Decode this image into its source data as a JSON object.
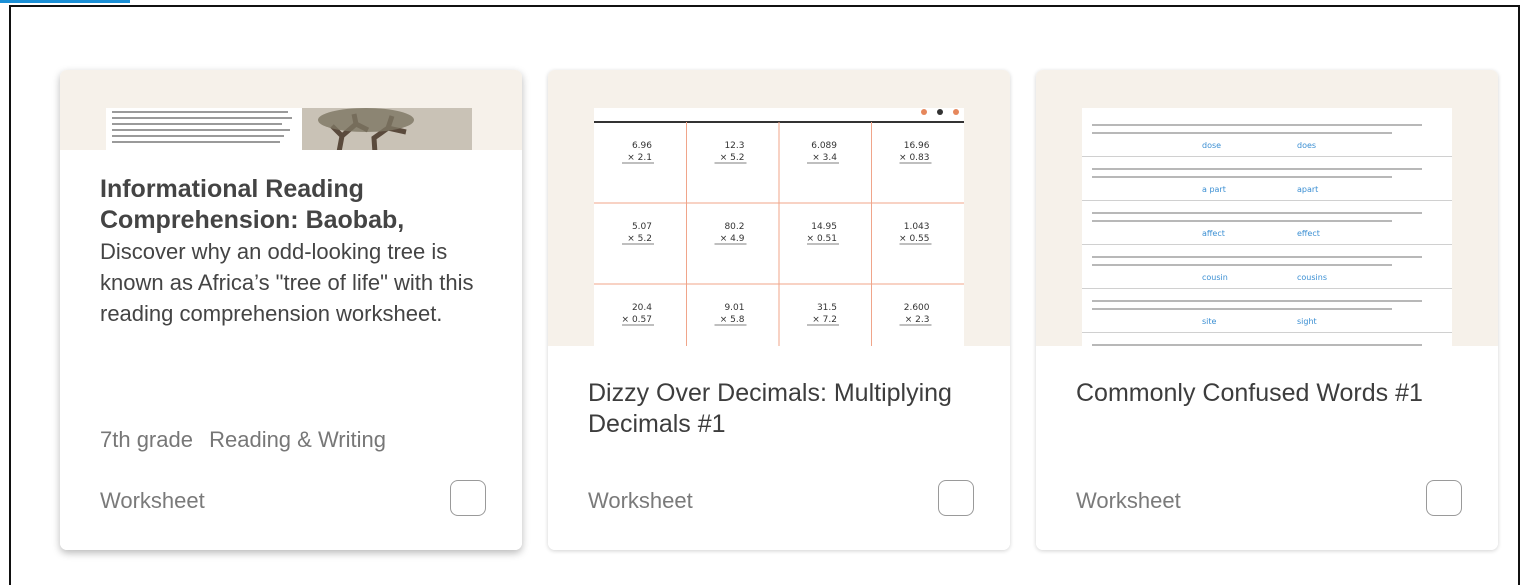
{
  "cards": [
    {
      "title": "Informational Reading Comprehension: Baobab,",
      "description": "Discover why an odd-looking tree is known as Africa’s \"tree of life\" with this reading comprehension worksheet.",
      "grade": "7th grade",
      "subject": "Reading & Writing",
      "type": "Worksheet",
      "checked": false
    },
    {
      "title": "Dizzy Over Decimals: Multiplying Decimals #1",
      "type": "Worksheet",
      "checked": false,
      "thumbnail_grid": [
        [
          "6.96\n× 2.1",
          "12.3\n× 5.2",
          "6.089\n× 3.4",
          "16.96\n× 0.83"
        ],
        [
          "5.07\n× 5.2",
          "80.2\n× 4.9",
          "14.95\n× 0.51",
          "1.043\n× 0.55"
        ],
        [
          "20.4\n× 0.57",
          "9.01\n× 5.8",
          "31.5\n× 7.2",
          "2.600\n× 2.3"
        ]
      ]
    },
    {
      "title": "Commonly Confused Words #1",
      "type": "Worksheet",
      "checked": false,
      "thumbnail_choices": [
        [
          "dose",
          "does"
        ],
        [
          "a part",
          "apart"
        ],
        [
          "affect",
          "effect"
        ],
        [
          "cousin",
          "cousins"
        ],
        [
          "site",
          "sight"
        ]
      ]
    }
  ],
  "colors": {
    "accent": "#1a8fd6",
    "thumbnail_bg": "#f6f1ea",
    "grid_line": "#f0a58a",
    "choice_text": "#3b8fd3"
  }
}
